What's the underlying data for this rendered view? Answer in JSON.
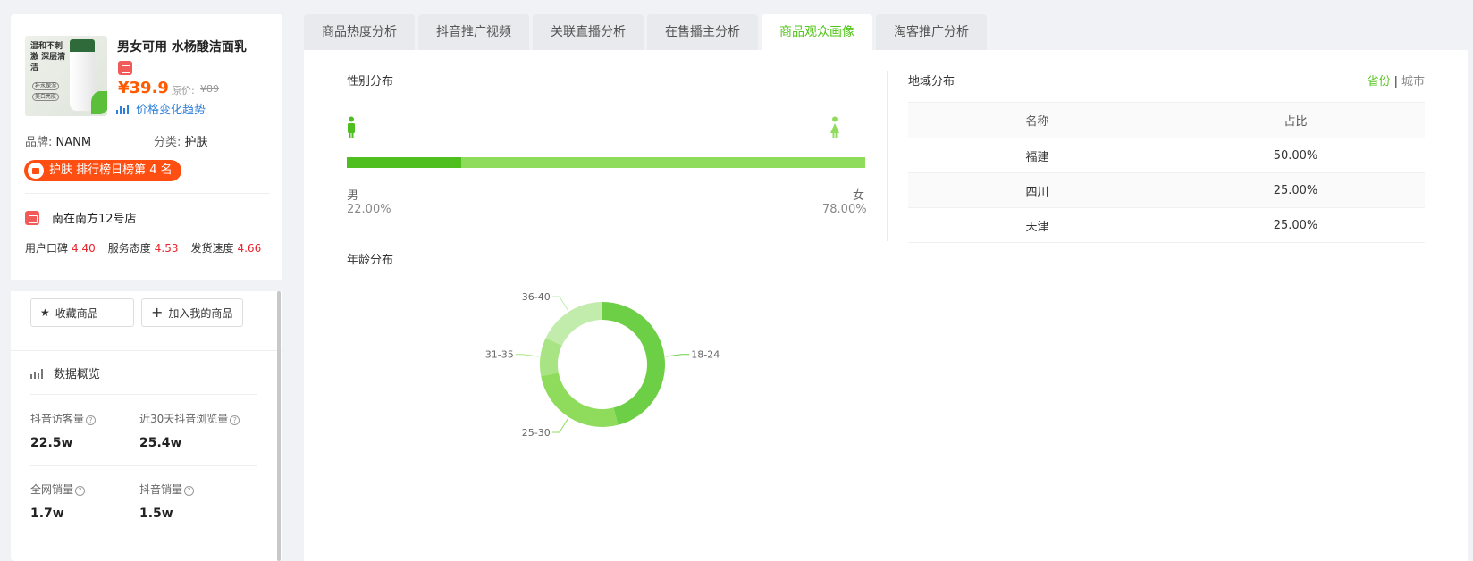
{
  "product": {
    "image_text": "温和不刺激 深层清洁",
    "image_pills": [
      "补水保湿",
      "美白亮肤"
    ],
    "title": "男女可用 水杨酸洁面乳",
    "price": "¥39.9",
    "original_label": "原价:",
    "original_price": "¥89",
    "trend_link": "价格变化趋势",
    "brand_key": "品牌:",
    "brand_value": "NANM",
    "category_key": "分类:",
    "category_value": "护肤",
    "rank_badge": "护肤 排行榜日榜第 4 名"
  },
  "store": {
    "name": "南在南方12号店",
    "scores": [
      {
        "label": "用户口碑",
        "value": "4.40"
      },
      {
        "label": "服务态度",
        "value": "4.53"
      },
      {
        "label": "发货速度",
        "value": "4.66"
      }
    ]
  },
  "actions": {
    "favorite": "收藏商品",
    "add_mine": "加入我的商品"
  },
  "overview": {
    "title": "数据概览",
    "stats": [
      {
        "label": "抖音访客量",
        "value": "22.5w"
      },
      {
        "label": "近30天抖音浏览量",
        "value": "25.4w"
      },
      {
        "label": "全网销量",
        "value": "1.7w"
      },
      {
        "label": "抖音销量",
        "value": "1.5w"
      }
    ]
  },
  "tabs": [
    "商品热度分析",
    "抖音推广视频",
    "关联直播分析",
    "在售播主分析",
    "商品观众画像",
    "淘客推广分析"
  ],
  "active_tab": 4,
  "gender": {
    "title": "性别分布",
    "male_label": "男",
    "female_label": "女",
    "male_pct": "22.00%",
    "female_pct": "78.00%",
    "male_value": 22,
    "colors": {
      "male": "#4fbf1f",
      "female": "#8fdc5c"
    }
  },
  "region": {
    "title": "地域分布",
    "switch_on": "省份",
    "switch_sep": "|",
    "switch_off": "城市",
    "columns": [
      "名称",
      "占比"
    ],
    "rows": [
      {
        "name": "福建",
        "pct": "50.00%"
      },
      {
        "name": "四川",
        "pct": "25.00%"
      },
      {
        "name": "天津",
        "pct": "25.00%"
      }
    ]
  },
  "age": {
    "title": "年龄分布"
  },
  "chart_data": {
    "type": "pie",
    "title": "年龄分布",
    "categories": [
      "18-24",
      "25-30",
      "31-35",
      "36-40"
    ],
    "values": [
      46,
      26,
      10,
      18
    ],
    "colors": [
      "#6dcf45",
      "#8fdc5c",
      "#a8e484",
      "#c2ecac"
    ]
  }
}
